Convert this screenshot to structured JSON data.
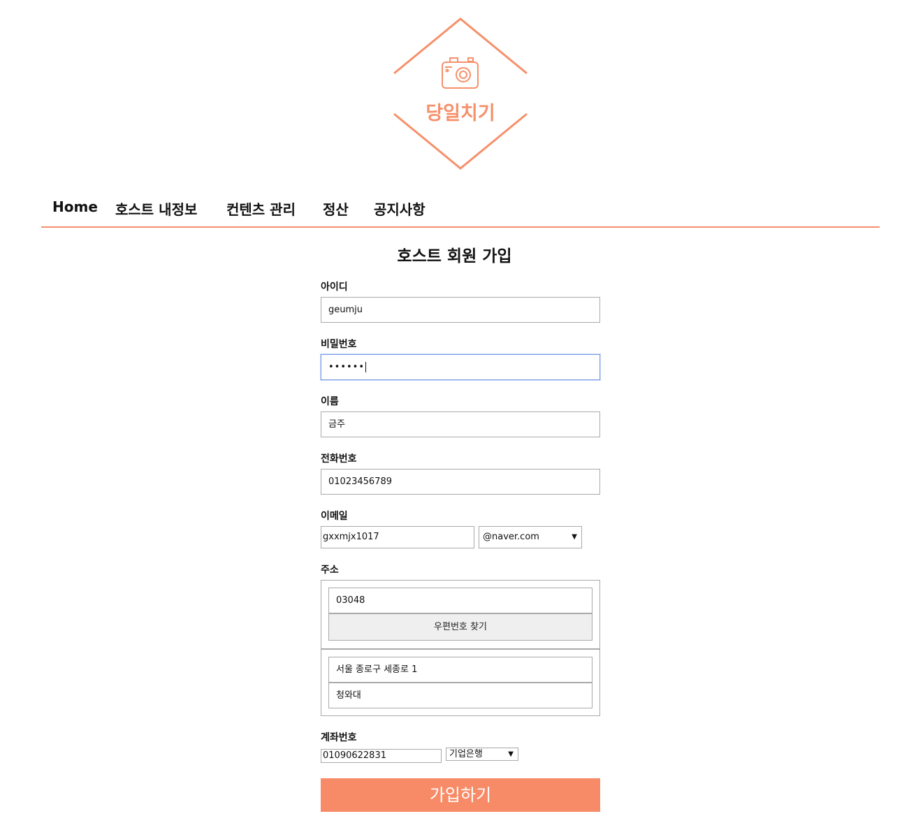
{
  "brand": {
    "name": "당일치기",
    "color": "#f6906b",
    "logo_icon": "camera-icon"
  },
  "nav": {
    "items": [
      {
        "label": "Home"
      },
      {
        "label": "호스트 내정보"
      },
      {
        "label": "컨텐츠 관리"
      },
      {
        "label": "정산"
      },
      {
        "label": "공지사항"
      }
    ]
  },
  "form": {
    "title": "호스트 회원 가입",
    "id": {
      "label": "아이디",
      "value": "geumju"
    },
    "password": {
      "label": "비밀번호",
      "value": "••••••"
    },
    "name": {
      "label": "이름",
      "value": "금주"
    },
    "phone": {
      "label": "전화번호",
      "value": "01023456789"
    },
    "email": {
      "label": "이메일",
      "value": "gxxmjx1017",
      "domain": "@naver.com"
    },
    "address": {
      "label": "주소",
      "zip": "03048",
      "zip_button": "우편번호 찾기",
      "line1": "서울 종로구 세종로 1",
      "line2": "청와대"
    },
    "account": {
      "label": "계좌번호",
      "value": "01090622831",
      "bank": "기업은행"
    },
    "submit": "가입하기"
  },
  "colors": {
    "accent": "#f88b67",
    "focus_border": "#7b9ee6"
  }
}
